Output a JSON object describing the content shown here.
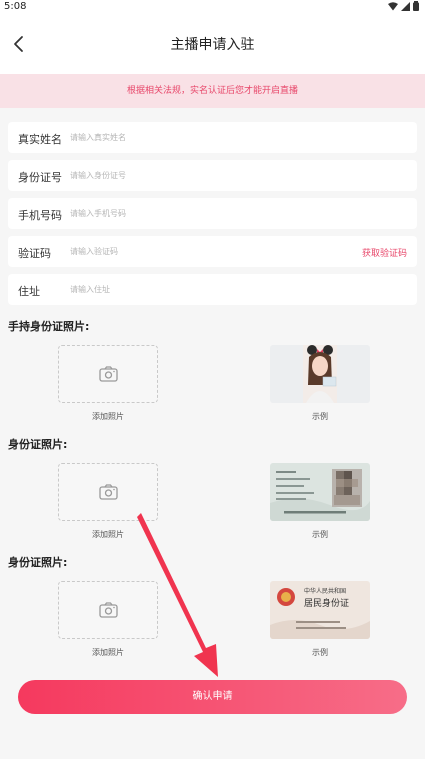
{
  "status_bar": {
    "time": "5:08"
  },
  "header": {
    "title": "主播申请入驻"
  },
  "notice": "根据相关法规，实名认证后您才能开启直播",
  "form": {
    "name": {
      "label": "真实姓名",
      "placeholder": "请输入真实姓名"
    },
    "id_number": {
      "label": "身份证号",
      "placeholder": "请输入身份证号"
    },
    "phone": {
      "label": "手机号码",
      "placeholder": "请输入手机号码"
    },
    "code": {
      "label": "验证码",
      "placeholder": "请输入验证码",
      "action": "获取验证码"
    },
    "address": {
      "label": "住址",
      "placeholder": "请输入住址"
    }
  },
  "sections": [
    {
      "title": "手持身份证照片:",
      "add_label": "添加照片",
      "example_label": "示例"
    },
    {
      "title": "身份证照片:",
      "add_label": "添加照片",
      "example_label": "示例"
    },
    {
      "title": "身份证照片:",
      "add_label": "添加照片",
      "example_label": "示例"
    }
  ],
  "id_card_back_text": {
    "line1": "中华人民共和国",
    "line2": "居民身份证"
  },
  "submit_label": "确认申请",
  "colors": {
    "accent": "#e8486b",
    "button_start": "#f5395e",
    "button_end": "#f76d88",
    "arrow": "#f0344f"
  }
}
